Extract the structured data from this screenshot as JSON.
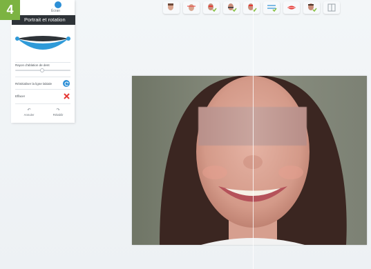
{
  "step_badge": "4",
  "panel": {
    "top_label": "Écran",
    "section_title": "Portrait et rotation",
    "option_1": "Rayon d'ablation de dent",
    "option_2": "Réinitialiser la ligne labiale",
    "option_3": "Effacer",
    "undo_label": "Annuler",
    "redo_label": "Rétablir"
  },
  "toolbar": {
    "tools": [
      {
        "icon": "face-profile-icon"
      },
      {
        "icon": "face-measure-icon"
      },
      {
        "icon": "face-check-icon"
      },
      {
        "icon": "face-check-icon"
      },
      {
        "icon": "face-check-icon"
      },
      {
        "icon": "align-lines-icon"
      },
      {
        "icon": "lips-icon"
      },
      {
        "icon": "face-check-icon"
      },
      {
        "icon": "layout-icon"
      }
    ]
  },
  "colors": {
    "accent": "#2c8fd6",
    "badge": "#7cb342",
    "delete": "#e53935",
    "check": "#8bc34a"
  }
}
